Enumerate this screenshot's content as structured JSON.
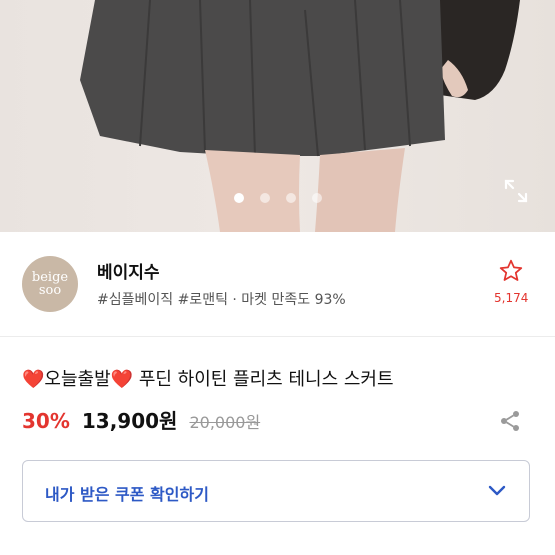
{
  "product_image": {
    "slides_total": 4,
    "active_slide": 1
  },
  "icons": {
    "expand": "expand-icon",
    "star": "star-outline-icon",
    "share": "share-icon",
    "chevron": "chevron-down-icon",
    "heart": "heart-icon"
  },
  "store": {
    "logo_line1": "beige",
    "logo_line2": "soo",
    "name": "베이지수",
    "tags": "#심플베이직 #로맨틱 · 마켓 만족도 93%",
    "favorite_count": "5,174"
  },
  "product": {
    "heart_left": "❤️",
    "badge_text": "오늘출발",
    "heart_right": "❤️",
    "title": " 푸딘 하이틴 플리츠 테니스 스커트",
    "discount": "30%",
    "price": "13,900원",
    "original_price": "20,000원"
  },
  "coupon": {
    "label": "내가 받은 쿠폰 확인하기"
  },
  "colors": {
    "accent_red": "#e3352f",
    "coupon_blue": "#2d59c5"
  }
}
